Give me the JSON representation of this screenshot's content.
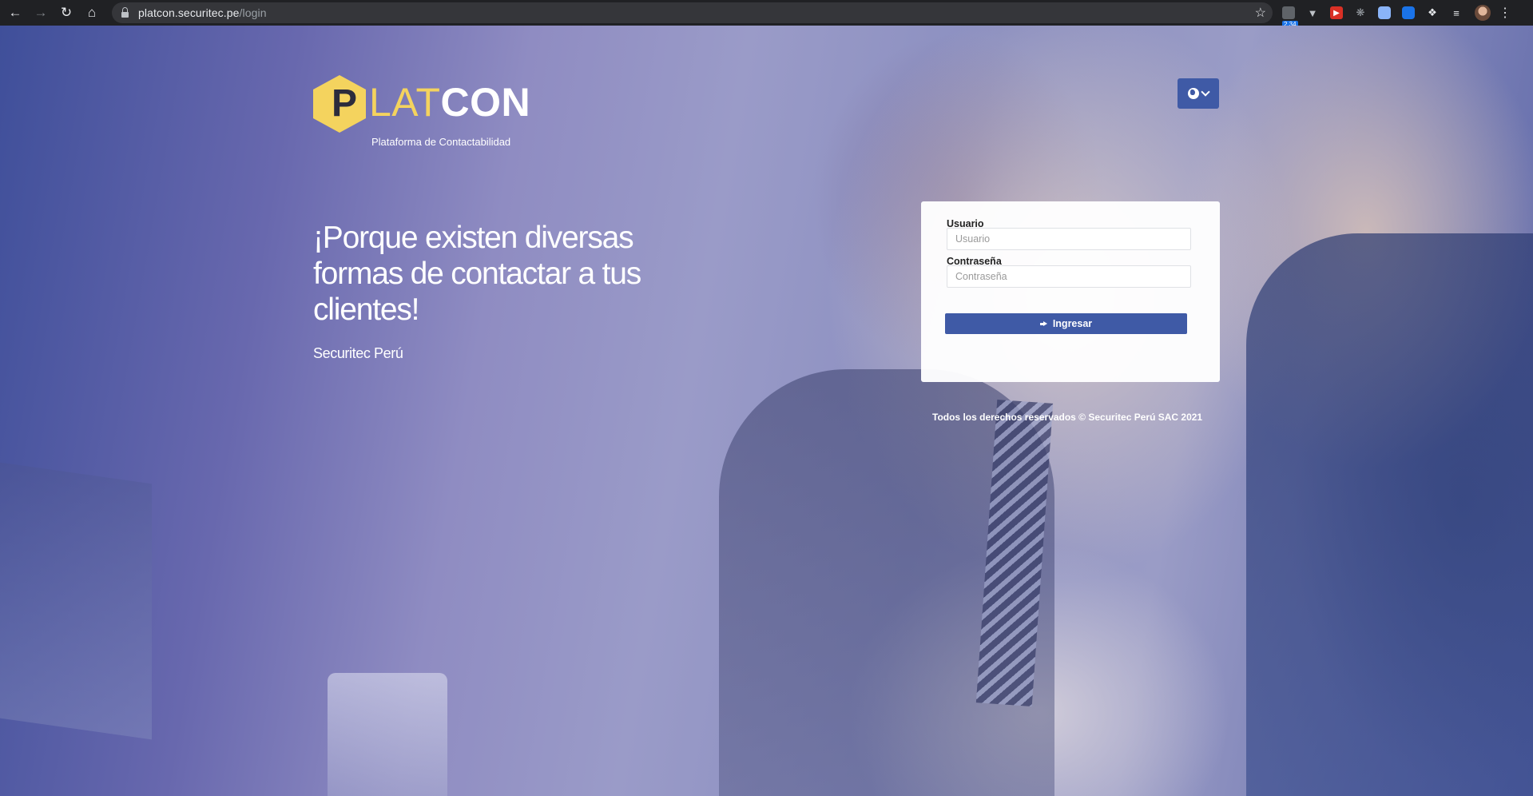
{
  "browser": {
    "url_domain": "platcon.securitec.pe",
    "url_path": "/login",
    "icons": {
      "back": "back-arrow-icon",
      "forward": "forward-arrow-icon",
      "reload": "reload-icon",
      "home": "home-icon",
      "bookmark": "star-icon"
    },
    "extensions": {
      "badge_text": "2.34"
    }
  },
  "logo": {
    "hex_letter": "P",
    "word_lat": "LAT",
    "word_con": "CON",
    "subtitle": "Plataforma de Contactabilidad"
  },
  "hero": {
    "headline": "¡Porque existen diversas formas de contactar a tus clientes!",
    "subheadline": "Securitec Perú"
  },
  "login": {
    "username_label": "Usuario",
    "username_placeholder": "Usuario",
    "password_label": "Contraseña",
    "password_placeholder": "Contraseña",
    "submit_label": "Ingresar"
  },
  "footer": {
    "text": "Todos los derechos reservados © Securitec Perú SAC 2021"
  },
  "colors": {
    "brand_yellow": "#f4d35e",
    "button_blue": "#3f5aa6",
    "chrome_bg": "#202124"
  }
}
